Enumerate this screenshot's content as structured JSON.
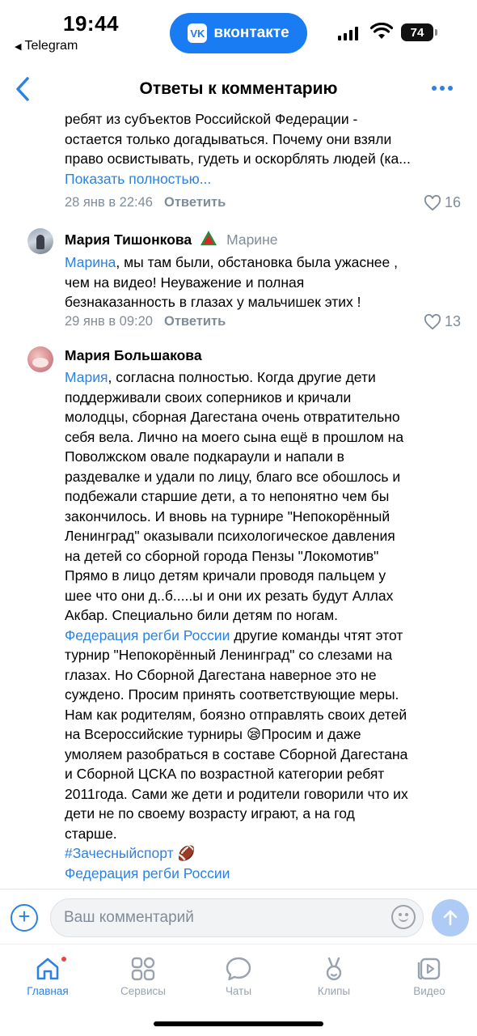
{
  "status_bar": {
    "time": "19:44",
    "back_app": "Telegram",
    "pill_label": "вконтакте",
    "battery": "74"
  },
  "header": {
    "title": "Ответы к комментарию"
  },
  "comments": [
    {
      "text_lines": [
        "ребят из субъектов Российской Федерации -",
        "остается только догадываться. Почему они взяли",
        "право освистывать, гудеть и оскорблять людей (ка..."
      ],
      "show_more": "Показать полностью...",
      "date": "28 янв в 22:46",
      "reply_label": "Ответить",
      "likes": "16"
    },
    {
      "author": "Мария Тишонкова",
      "reply_to": "Марине",
      "mention": "Марина",
      "text_after_mention": ", мы там были, обстановка была ужаснее ,",
      "text_lines": [
        "чем на видео! Неуважение  и полная",
        "безнаказанность в глазах у мальчишек этих !"
      ],
      "date": "29 янв в 09:20",
      "reply_label": "Ответить",
      "likes": "13"
    },
    {
      "author": "Мария Большакова",
      "mention": "Мария",
      "text_after_mention": ", согласна полностью. Когда другие дети",
      "text_lines": [
        "поддерживали своих соперников и кричали",
        "молодцы, сборная Дагестана очень отвратительно",
        "себя вела. Лично на моего сына ещё в прошлом на",
        "Поволжском овале подкараули и  напали в",
        "раздевалке и удали по лицу, благо все обошлось и",
        "подбежали старшие дети, а то непонятно чем бы",
        "закончилось. И вновь на турнире \"Непокорённый",
        "Ленинград\" оказывали психологическое давления",
        "на детей со сборной города Пензы \"Локомотив\"",
        "Прямо в лицо детям кричали проводя пальцем у",
        "шее что они д..б.....ы и они их резать будут Аллах",
        "Акбар. Специально били детям по ногам."
      ],
      "link_mention": "Федерация регби России",
      "link_after": "  другие команды чтят этот",
      "text_lines_2": [
        "турнир \"Непокорённый Ленинград\" со слезами на",
        "глазах. Но Сборной Дагестана наверное это не",
        "суждено. Просим принять соответствующие меры.",
        "Нам как родителям, боязно отправлять своих детей"
      ],
      "line_emoji_before": "на Всероссийские турниры ",
      "emoji_sad": "😪",
      "line_emoji_after": "Просим и даже",
      "text_lines_3": [
        "умоляем разобраться в составе Сборной Дагестана",
        "и Сборной ЦСКА по возрастной категории ребят",
        "2011года. Сами же дети и родители говорили что их",
        "дети не по своему возрасту играют, а на год",
        "старше."
      ],
      "hashtag": "#Зачесныйспорт",
      "emoji_ball": "🏈",
      "link_mention_2": "Федерация регби России"
    }
  ],
  "input": {
    "placeholder": "Ваш комментарий"
  },
  "tabs": [
    {
      "label": "Главная",
      "icon": "home-icon",
      "active": true
    },
    {
      "label": "Сервисы",
      "icon": "services-icon"
    },
    {
      "label": "Чаты",
      "icon": "chat-icon"
    },
    {
      "label": "Клипы",
      "icon": "clips-icon"
    },
    {
      "label": "Видео",
      "icon": "video-icon"
    }
  ],
  "colors": {
    "accent": "#2d81e0",
    "meta": "#818c99",
    "pill": "#1a7cf2"
  }
}
